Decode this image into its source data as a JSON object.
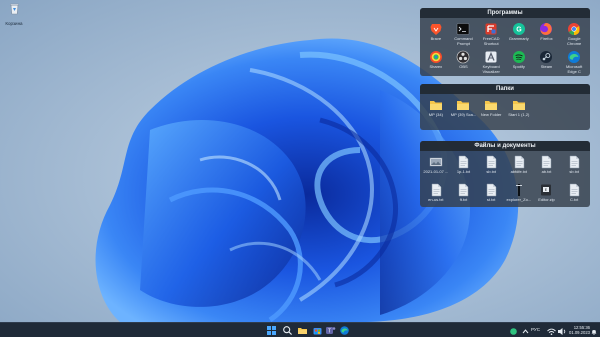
{
  "desktop": {
    "icons": [
      {
        "label": "Корзина",
        "icon": "recycle-bin-icon"
      }
    ]
  },
  "fences": [
    {
      "title": "Программы",
      "items": [
        {
          "label": "Brave",
          "icon": "brave-icon",
          "color": "#fb542b"
        },
        {
          "label": "Command Prompt",
          "icon": "terminal-icon",
          "color": "#0c0c0c"
        },
        {
          "label": "FreeCAD Shortcut",
          "icon": "freecad-icon",
          "color": "#3b6fd6"
        },
        {
          "label": "Grammarly",
          "icon": "grammarly-icon",
          "color": "#15c39a"
        },
        {
          "label": "Firefox",
          "icon": "firefox-icon",
          "color": "#ff7139"
        },
        {
          "label": "Google Chrome",
          "icon": "chrome-icon",
          "color": "#4285f4"
        },
        {
          "label": "Sharex",
          "icon": "sharex-icon",
          "color": "#2dbb5c"
        },
        {
          "label": "OBS",
          "icon": "obs-icon",
          "color": "#302e31"
        },
        {
          "label": "Keyboard Visualizer",
          "icon": "keyboard-visualizer-icon",
          "color": "#5a6170"
        },
        {
          "label": "Spotify",
          "icon": "spotify-icon",
          "color": "#1db954"
        },
        {
          "label": "Steam",
          "icon": "steam-icon",
          "color": "#1b2838"
        },
        {
          "label": "Microsoft Edge C",
          "icon": "edge-icon",
          "color": "#0f7bd8"
        }
      ]
    },
    {
      "title": "Папки",
      "items": [
        {
          "label": "MP (34)",
          "icon": "folder-icon",
          "color": "#f6c64b"
        },
        {
          "label": "MP (39) Sca...",
          "icon": "folder-icon",
          "color": "#f6c64b"
        },
        {
          "label": "New Folder",
          "icon": "folder-icon",
          "color": "#f6c64b"
        },
        {
          "label": "Start 1 (1,2)",
          "icon": "folder-icon",
          "color": "#f6c64b"
        }
      ]
    },
    {
      "title": "Файлы и документы",
      "items": [
        {
          "label": "2021-01-07 ...",
          "icon": "image-file-icon",
          "color": "#9aa7b8"
        },
        {
          "label": "1p-1.txt",
          "icon": "document-icon",
          "color": "#e8edf3"
        },
        {
          "label": "sb.txt",
          "icon": "document-icon",
          "color": "#e8edf3"
        },
        {
          "label": "abfdfe.txt",
          "icon": "document-icon",
          "color": "#e8edf3"
        },
        {
          "label": "ab.txt",
          "icon": "document-icon",
          "color": "#e8edf3"
        },
        {
          "label": "sb.txt",
          "icon": "document-icon",
          "color": "#e8edf3"
        },
        {
          "label": "en-us.txt",
          "icon": "document-icon",
          "color": "#e8edf3"
        },
        {
          "label": "ft.txt",
          "icon": "document-icon",
          "color": "#e8edf3"
        },
        {
          "label": "st.txt",
          "icon": "document-icon",
          "color": "#e8edf3"
        },
        {
          "label": "explorer_Zo...",
          "icon": "pinned-file-icon",
          "color": "#cfd6de"
        },
        {
          "label": "Editor.zip",
          "icon": "zip-archive-icon",
          "color": "#2a2f36"
        },
        {
          "label": "C.txt",
          "icon": "document-icon",
          "color": "#e8edf3"
        }
      ]
    }
  ],
  "taskbar": {
    "apps": [
      {
        "name": "start",
        "icon": "windows-start-icon"
      },
      {
        "name": "search",
        "icon": "search-icon"
      },
      {
        "name": "file-explorer",
        "icon": "folder-icon"
      },
      {
        "name": "store",
        "icon": "store-icon"
      },
      {
        "name": "teams",
        "icon": "teams-icon"
      },
      {
        "name": "edge",
        "icon": "edge-icon"
      }
    ],
    "tray": {
      "language": "РУС",
      "time": "12:55:36",
      "date": "01.09.2023"
    }
  },
  "colors": {
    "accent": "#1f5fe0",
    "taskbar": "#1f2a38",
    "fence_bg": "#343e4a"
  }
}
